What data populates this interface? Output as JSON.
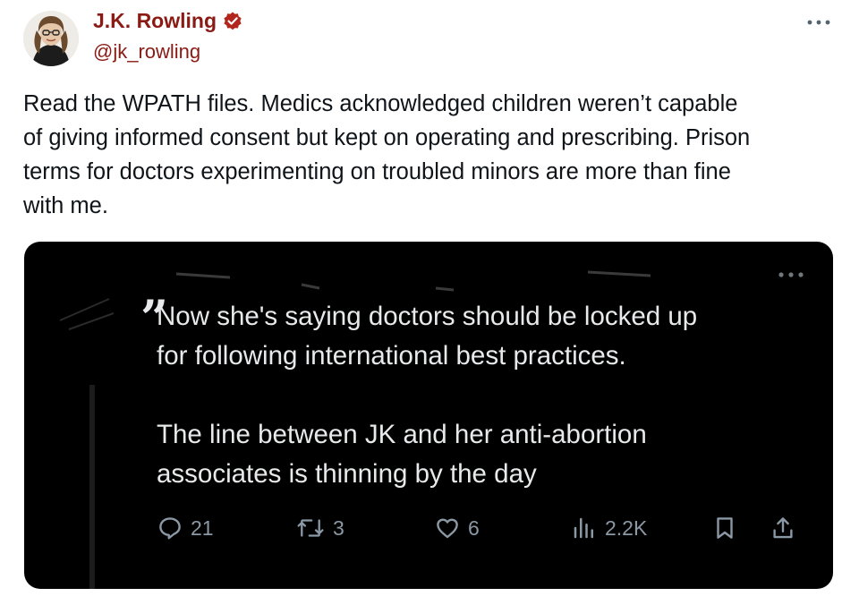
{
  "author": {
    "display_name": "J.K. Rowling",
    "handle": "@jk_rowling",
    "verified_badge_color": "#b3261e"
  },
  "tweet": {
    "text_lines": [
      "Read the WPATH files. Medics acknowledged children weren’t capable",
      "of giving informed consent but kept on operating and prescribing. Prison",
      "terms for doctors experimenting on troubled minors are more than fine",
      "with me."
    ]
  },
  "embedded_post": {
    "quote_mark": "”",
    "text_lines": [
      "Now she's saying doctors should be locked up",
      "for following international best practices.",
      "The line between JK and her anti-abortion",
      "associates is thinning by the day"
    ],
    "stats": {
      "replies": "21",
      "reposts": "3",
      "likes": "6",
      "views": "2.2K"
    },
    "icons": [
      "reply-icon",
      "repost-icon",
      "like-icon",
      "views-icon",
      "bookmark-icon",
      "share-icon"
    ]
  },
  "colors": {
    "name_color": "#8a1a14",
    "text_color": "#0f1419",
    "media_background": "#000000",
    "media_text": "#e7e9ea",
    "media_icon": "#8b98a5"
  }
}
